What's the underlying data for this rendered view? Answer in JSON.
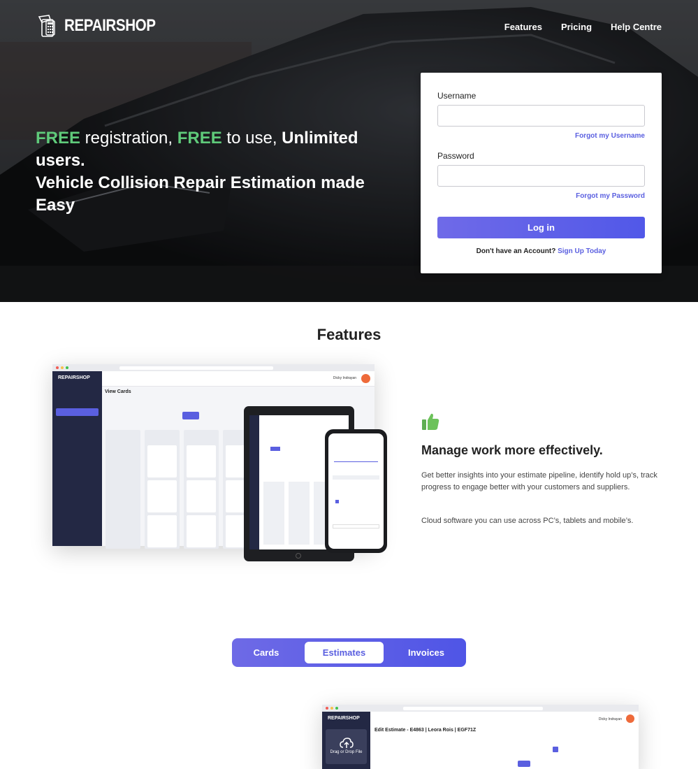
{
  "header": {
    "brand": "REPAIRSHOP",
    "nav": [
      "Features",
      "Pricing",
      "Help Centre"
    ]
  },
  "hero": {
    "line1_free1": "FREE",
    "line1_reg": " registration, ",
    "line1_free2": "FREE",
    "line1_to": " to use, ",
    "line1_bold": "Unlimited users.",
    "line2": "Vehicle Collision Repair Estimation made Easy"
  },
  "login": {
    "username_label": "Username",
    "username_value": "",
    "forgot_username": "Forgot my Username",
    "password_label": "Password",
    "password_value": "",
    "forgot_password": "Forgot my Password",
    "login_button": "Log in",
    "no_account": "Don't have an Account?",
    "signup_link": "Sign Up Today"
  },
  "features": {
    "title": "Features",
    "heading": "Manage work more effectively.",
    "para1": "Get better insights into your estimate pipeline, identify hold up’s, track progress to engage better with your customers and suppliers.",
    "para2": "Cloud software you can use across PC’s, tablets and mobile’s."
  },
  "mock": {
    "app_logo": "REPAIRSHOP",
    "view_title": "View Cards",
    "sidebar_items": [
      "Workcenter",
      "Cards",
      "Estimates",
      "Invoices",
      "Estimate Templat...",
      "Suppliers",
      "Customers",
      "Insurers",
      "Assessors",
      "Advanced Settings",
      "Sign out"
    ],
    "user_name": "Dicky Indrayan",
    "estimate_title": "Edit Estimate - E4863 | Leora Rois | EGF71Z",
    "drop_label": "Drag or Drop File"
  },
  "tabs": {
    "items": [
      "Cards",
      "Estimates",
      "Invoices"
    ],
    "active": "Estimates"
  },
  "colors": {
    "accent": "#5a5fe0",
    "free_green": "#5fca7a",
    "sidebar_dark": "#232844"
  }
}
